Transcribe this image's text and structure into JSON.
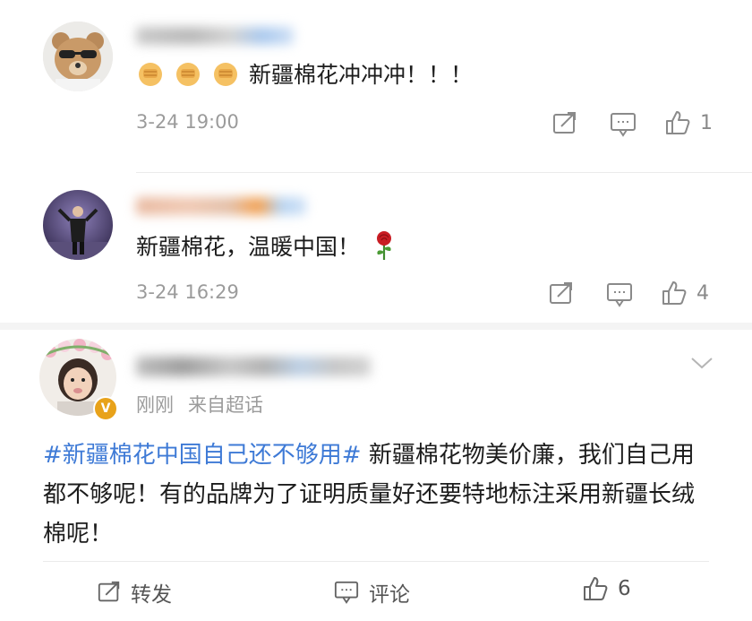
{
  "comments": [
    {
      "avatar": "teddy-bear-sunglasses",
      "emoji": [
        "fist-icon",
        "fist-icon",
        "fist-icon"
      ],
      "text": "新疆棉花冲冲冲！！！",
      "time": "3-24 19:00",
      "likes": "1"
    },
    {
      "avatar": "man-on-stage",
      "text": "新疆棉花，温暖中国！",
      "emoji_after": "rose-icon",
      "time": "3-24 16:29",
      "likes": "4"
    }
  ],
  "post": {
    "avatar": "girl-with-flower-crown",
    "badge": "V",
    "time": "刚刚",
    "source": "来自超话",
    "topic": "#新疆棉花中国自己还不够用#",
    "text": " 新疆棉花物美价廉，我们自己用都不够呢！有的品牌为了证明质量好还要特地标注采用新疆长绒棉呢！",
    "actions": {
      "repost": "转发",
      "comment": "评论",
      "likes": "6"
    }
  },
  "colors": {
    "topic": "#3e7ad6",
    "badge": "#e8a21a",
    "meta": "#9b9b9b"
  }
}
